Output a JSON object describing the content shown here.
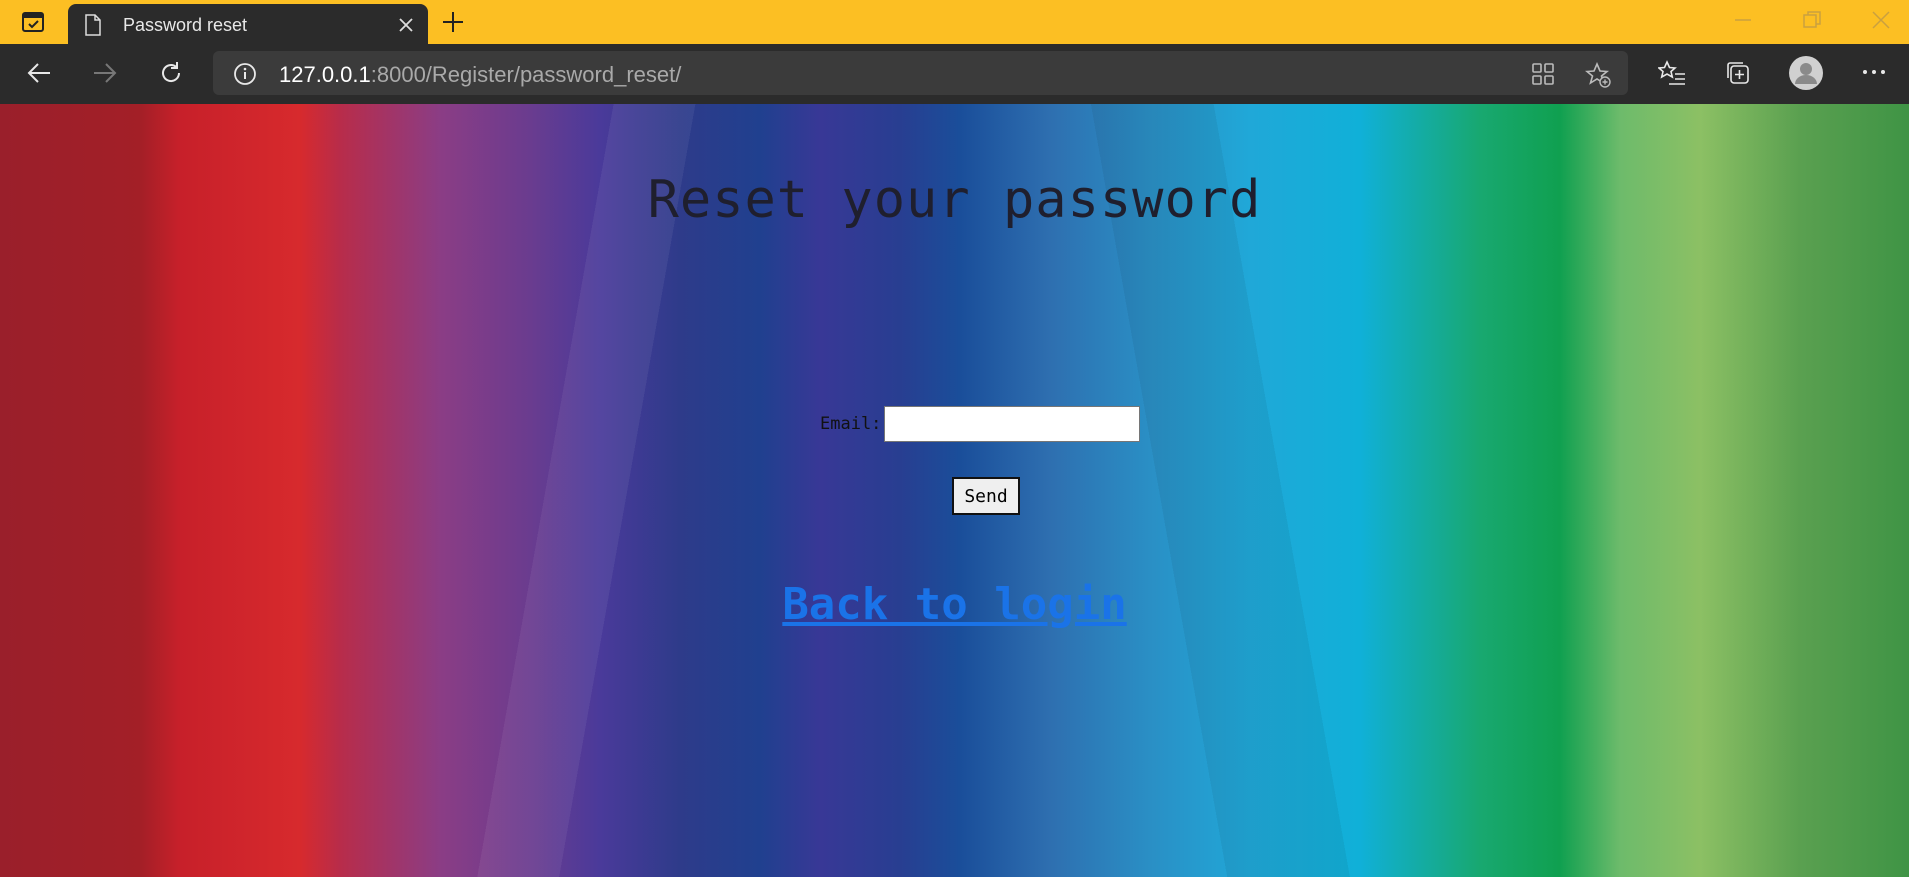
{
  "browser": {
    "tab_title": "Password reset",
    "url_host": "127.0.0.1",
    "url_rest": ":8000/Register/password_reset/",
    "tabbar_color": "#fcbf23",
    "toolbar_color": "#2b2b2b"
  },
  "page": {
    "title": "Reset your password",
    "email_label": "Email:",
    "email_value": "",
    "send_label": "Send",
    "back_link": "Back to login",
    "link_color": "#1a73e8"
  }
}
